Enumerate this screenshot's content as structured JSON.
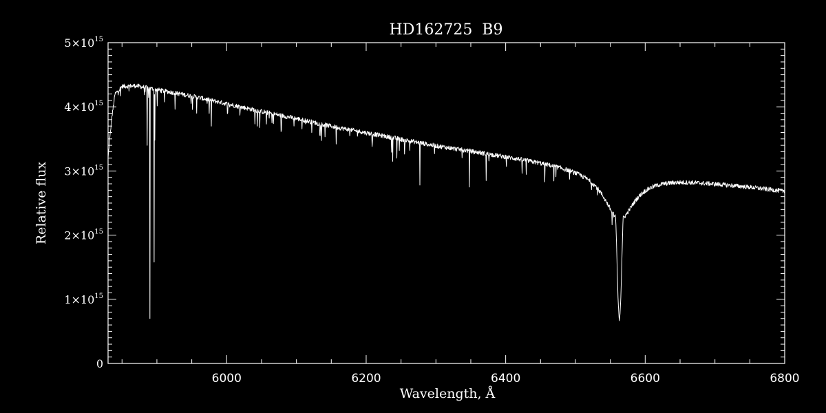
{
  "chart_data": {
    "type": "line",
    "title": "HD162725  B9",
    "xlabel": "Wavelength, Å",
    "ylabel": "Relative flux",
    "xlim": [
      5830,
      6800
    ],
    "ylim": [
      0,
      5000000000000000.0
    ],
    "x_ticks": [
      6000,
      6200,
      6400,
      6600,
      6800
    ],
    "x_tick_labels": [
      "6000",
      "6200",
      "6400",
      "6600",
      "6800"
    ],
    "y_ticks": [
      0,
      1000000000000000.0,
      2000000000000000.0,
      3000000000000000.0,
      4000000000000000.0,
      5000000000000000.0
    ],
    "y_tick_labels": [
      {
        "mantissa": "0",
        "times": "",
        "base": "",
        "exp": ""
      },
      {
        "mantissa": "1",
        "times": "×",
        "base": "10",
        "exp": "15"
      },
      {
        "mantissa": "2",
        "times": "×",
        "base": "10",
        "exp": "15"
      },
      {
        "mantissa": "3",
        "times": "×",
        "base": "10",
        "exp": "15"
      },
      {
        "mantissa": "4",
        "times": "×",
        "base": "10",
        "exp": "15"
      },
      {
        "mantissa": "5",
        "times": "×",
        "base": "10",
        "exp": "15"
      }
    ],
    "grid": false,
    "colors": {
      "background": "#000000",
      "foreground": "#ffffff"
    },
    "series": [
      {
        "continuum": {
          "x": [
            5830,
            5835,
            5840,
            5850,
            5870,
            5900,
            5950,
            6000,
            6050,
            6100,
            6150,
            6200,
            6250,
            6300,
            6350,
            6400,
            6450,
            6500,
            6530,
            6600,
            6650,
            6700,
            6750,
            6800
          ],
          "y": [
            3200000000000000.0,
            3800000000000000.0,
            4200000000000000.0,
            4320000000000000.0,
            4330000000000000.0,
            4270000000000000.0,
            4170000000000000.0,
            4050000000000000.0,
            3930000000000000.0,
            3820000000000000.0,
            3700000000000000.0,
            3600000000000000.0,
            3500000000000000.0,
            3400000000000000.0,
            3320000000000000.0,
            3240000000000000.0,
            3160000000000000.0,
            3080000000000000.0,
            3040000000000000.0,
            2930000000000000.0,
            2880000000000000.0,
            2820000000000000.0,
            2760000000000000.0,
            2690000000000000.0
          ]
        },
        "balmer_line": {
          "center": 6563,
          "min": 700000000000000.0,
          "core_width": 3.5,
          "wing_width": 26,
          "wing_depth": 0.25
        },
        "absorption_lines": [
          {
            "x": 5890,
            "min": 700000000000000.0
          },
          {
            "x": 5896,
            "min": 1580000000000000.0
          },
          {
            "x": 5886,
            "min": 3400000000000000.0
          },
          {
            "x": 5897,
            "min": 3480000000000000.0
          },
          {
            "x": 5957,
            "min": 3900000000000000.0
          },
          {
            "x": 5978,
            "min": 3700000000000000.0
          },
          {
            "x": 6044,
            "min": 3700000000000000.0
          },
          {
            "x": 6065,
            "min": 3750000000000000.0
          },
          {
            "x": 6122,
            "min": 3600000000000000.0
          },
          {
            "x": 6157,
            "min": 3420000000000000.0
          },
          {
            "x": 6238,
            "min": 3150000000000000.0
          },
          {
            "x": 6244,
            "min": 3200000000000000.0
          },
          {
            "x": 6277,
            "min": 2780000000000000.0
          },
          {
            "x": 6348,
            "min": 2750000000000000.0
          },
          {
            "x": 6372,
            "min": 2850000000000000.0
          },
          {
            "x": 6456,
            "min": 2830000000000000.0
          }
        ]
      }
    ]
  }
}
